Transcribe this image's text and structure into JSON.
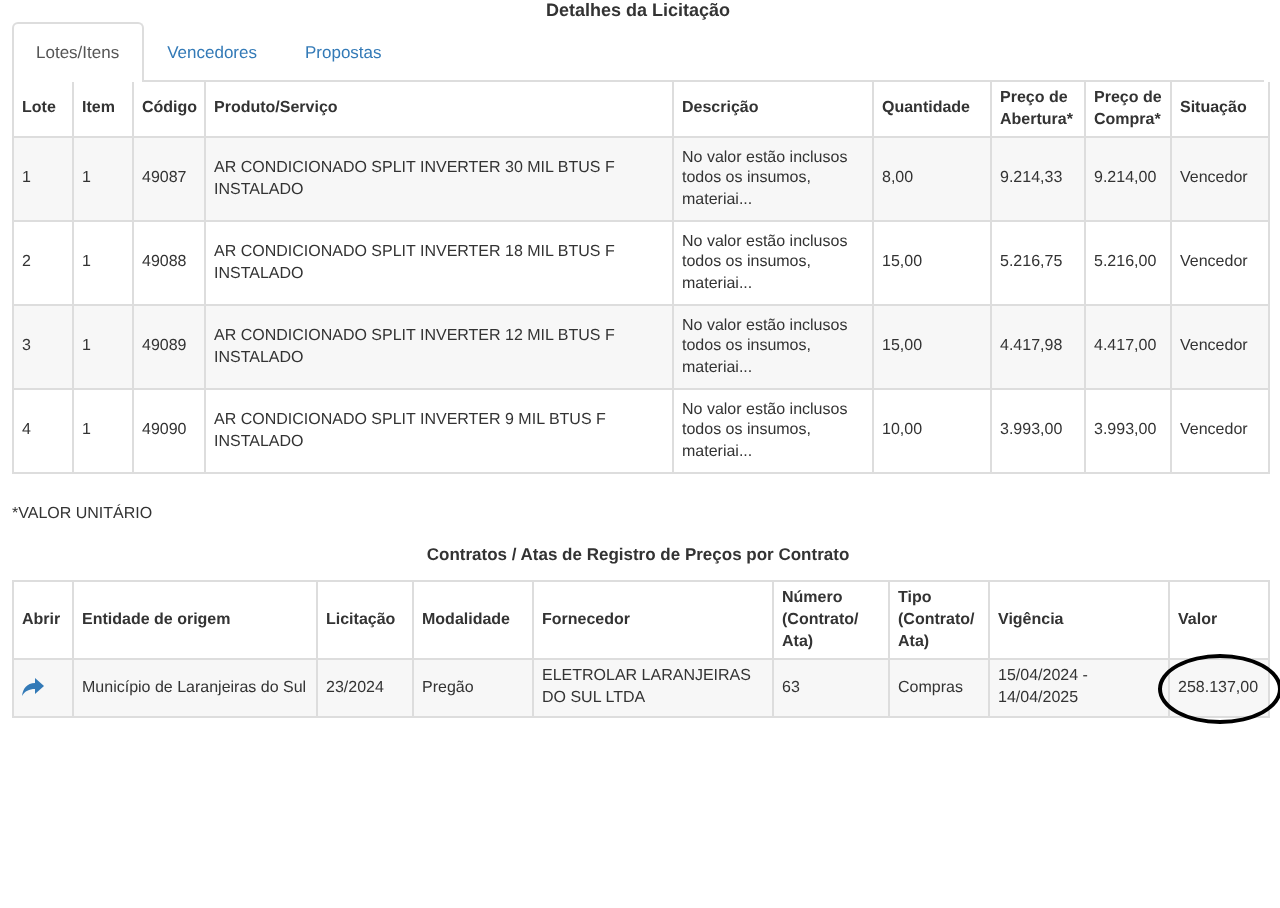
{
  "title": "Detalhes da Licitação",
  "tabs": [
    {
      "label": "Lotes/Itens",
      "selected": true
    },
    {
      "label": "Vencedores",
      "selected": false
    },
    {
      "label": "Propostas",
      "selected": false
    }
  ],
  "items_table": {
    "columns": [
      "Lote",
      "Item",
      "Código",
      "Produto/Serviço",
      "Descrição",
      "Quantidade",
      "Preço de Abertura*",
      "Preço de Compra*",
      "Situação"
    ],
    "rows": [
      [
        "1",
        "1",
        "49087",
        "AR CONDICIONADO SPLIT INVERTER 30 MIL BTUS F  INSTALADO",
        "No valor estão inclusos todos os insumos, materiai...",
        "8,00",
        "9.214,33",
        "9.214,00",
        "Vencedor"
      ],
      [
        "2",
        "1",
        "49088",
        "AR CONDICIONADO SPLIT INVERTER 18 MIL BTUS F  INSTALADO",
        "No valor estão inclusos todos os insumos, materiai...",
        "15,00",
        "5.216,75",
        "5.216,00",
        "Vencedor"
      ],
      [
        "3",
        "1",
        "49089",
        "AR CONDICIONADO SPLIT INVERTER 12 MIL BTUS F  INSTALADO",
        "No valor estão inclusos todos os insumos, materiai...",
        "15,00",
        "4.417,98",
        "4.417,00",
        "Vencedor"
      ],
      [
        "4",
        "1",
        "49090",
        "AR CONDICIONADO SPLIT INVERTER 9 MIL BTUS F  INSTALADO",
        "No valor estão inclusos todos os insumos, materiai...",
        "10,00",
        "3.993,00",
        "3.993,00",
        "Vencedor"
      ]
    ]
  },
  "footnote": "*VALOR UNITÁRIO",
  "contracts": {
    "title": "Contratos / Atas de Registro de Preços por Contrato",
    "columns": [
      "Abrir",
      "Entidade de origem",
      "Licitação",
      "Modalidade",
      "Fornecedor",
      "Número (Contrato/ Ata)",
      "Tipo (Contrato/ Ata)",
      "Vigência",
      "Valor"
    ],
    "rows": [
      {
        "cells": [
          "",
          "Município de Laranjeiras do Sul",
          "23/2024",
          "Pregão",
          "ELETROLAR LARANJEIRAS DO SUL LTDA",
          "63",
          "Compras",
          "15/04/2024 - 14/04/2025",
          "258.137,00"
        ],
        "value_circled": true
      }
    ]
  }
}
